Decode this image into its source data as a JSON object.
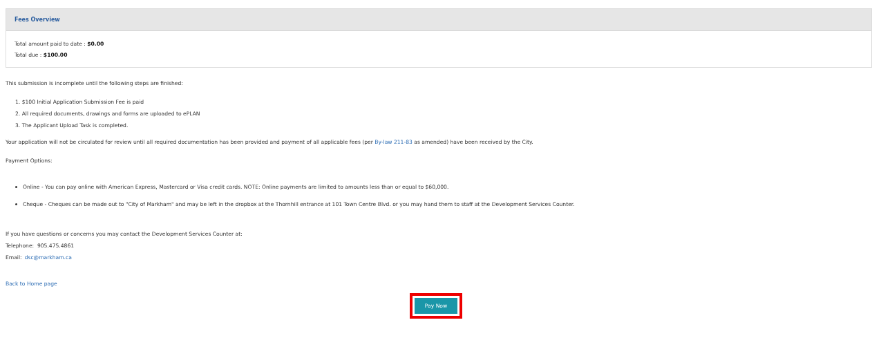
{
  "fees_panel": {
    "title": "Fees Overview",
    "lines": [
      {
        "label": "Total amount paid to date : ",
        "value": "$0.00"
      },
      {
        "label": "Total due : ",
        "value": "$100.00"
      }
    ]
  },
  "intro": "This submission is incomplete until the following steps are finished:",
  "steps": [
    {
      "number": "1.",
      "text": "$100 Initial Application Submission Fee is paid"
    },
    {
      "number": "2.",
      "text": "All required documents, drawings and forms are uploaded to ePLAN"
    },
    {
      "number": "3.",
      "text": "The Applicant Upload Task is completed."
    }
  ],
  "notice": {
    "before": "Your application will not be circulated for review until all required documentation has been provided and payment of all applicable fees (per ",
    "link": "By-law 211-83",
    "after": " as amended) have been received by the City."
  },
  "payment_heading": "Payment Options:",
  "payment_options": [
    "Online - You can pay online with American Express, Mastercard or Visa credit cards. NOTE: Online payments are limited to amounts less than or equal to $60,000.",
    "Cheque - Cheques can be made out to \"City of Markham\" and may be left in the dropbox at the Thornhill entrance at 101 Town Centre Blvd. or you may hand them to staff at the Development Services Counter."
  ],
  "contact": {
    "intro": "If you have questions or concerns you may contact the Development Services Counter at:",
    "telephone_label": "Telephone:",
    "telephone": "905.475.4861",
    "email_label": "Email:",
    "email": "dsc@markham.ca"
  },
  "back_link": "Back to Home page",
  "pay_button": {
    "label": "Pay Now",
    "highlighted": true
  }
}
